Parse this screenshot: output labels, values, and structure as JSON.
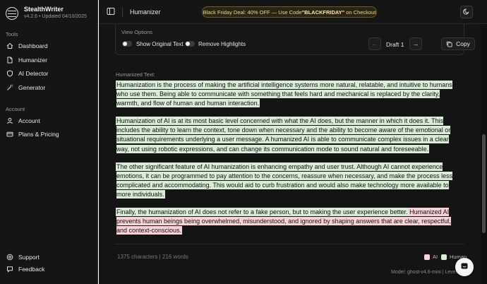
{
  "brand": {
    "name": "StealthWriter",
    "version": "v4.2.6 • Updated 04/10/2025"
  },
  "sidebar": {
    "tools_label": "Tools",
    "tools": [
      {
        "label": "Dashboard",
        "icon": "home-icon"
      },
      {
        "label": "Humanizer",
        "icon": "file-icon"
      },
      {
        "label": "AI Detector",
        "icon": "shield-icon"
      },
      {
        "label": "Generator",
        "icon": "wand-icon"
      }
    ],
    "account_label": "Account",
    "account": [
      {
        "label": "Account",
        "icon": "user-icon"
      },
      {
        "label": "Plans & Pricing",
        "icon": "card-icon"
      }
    ],
    "bottom": [
      {
        "label": "Support",
        "icon": "help-icon"
      },
      {
        "label": "Feedback",
        "icon": "feedback-icon"
      }
    ]
  },
  "header": {
    "title": "Humanizer",
    "promo_prefix": "Black Friday Deal: 40% OFF — Use Code ",
    "promo_code": "\"BLACKFRIDAY\"",
    "promo_suffix": " on Checkout"
  },
  "view_options": {
    "label": "View Options",
    "show_original": "Show Original Text",
    "remove_highlights": "Remove Highlights",
    "draft_label": "Draft 1",
    "copy_label": "Copy"
  },
  "humanized_label": "Humanized Text:",
  "paragraphs": [
    [
      {
        "text": "Humanization is the process of making the artificial intelligence systems more natural, relatable, and intuitive to humans who use them.",
        "kind": "human"
      },
      {
        "text": "Being able to communicate with something that feels hard and mechanical is replaced by the clarity, warmth, and flow of human and human interaction.",
        "kind": "human"
      }
    ],
    [
      {
        "text": "Humanization of AI is at its most basic level concerned with what the AI does, but the manner in which it does it.",
        "kind": "human"
      },
      {
        "text": "This includes the ability to learn the context, tone down when necessary and the ability to become aware of the emotional or situational requirements underlying a user message.",
        "kind": "human"
      },
      {
        "text": "A humanized AI is able to communicate complex issues in a clear way, not using robotic expressions, and can change its communication mode to sound natural and foreseeable.",
        "kind": "human"
      }
    ],
    [
      {
        "text": "The other significant feature of AI humanization is enhancing empathy and user trust.",
        "kind": "human"
      },
      {
        "text": "Although AI cannot experience emotions, it can be programmed to pay attention to the concerns, reassure when necessary, and make the process less complicated and accommodating.",
        "kind": "human"
      },
      {
        "text": "This would aid to curb frustration and would also make technology more available to more individuals.",
        "kind": "human"
      }
    ],
    [
      {
        "text": "Finally, the humanization of AI does not refer to a fake person, but to making the user experience better.",
        "kind": "human"
      },
      {
        "text": "Humanized AI prevents human beings being overwhelmed, misunderstood, and ignored by shaping answers that are clear, respectful, and context-conscious.",
        "kind": "ai"
      }
    ]
  ],
  "stats": "1375 characters | 216 words",
  "legend": {
    "ai": "AI",
    "human": "Human",
    "ai_color": "#f8d2d7",
    "human_color": "#d8ecd6"
  },
  "model_info": "Model: ghost-v4.6-mini | Level:"
}
